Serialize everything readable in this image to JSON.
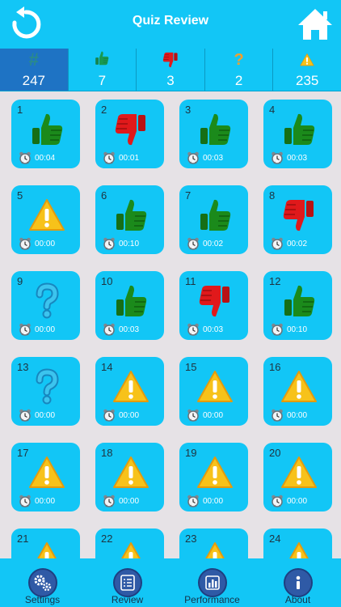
{
  "header": {
    "title": "Quiz Review"
  },
  "stats": [
    {
      "id": "total",
      "icon": "hash-icon",
      "glyph": "#",
      "value": "247",
      "active": true
    },
    {
      "id": "correct",
      "icon": "thumbs-up-icon",
      "value": "7",
      "active": false
    },
    {
      "id": "wrong",
      "icon": "thumbs-down-icon",
      "value": "3",
      "active": false
    },
    {
      "id": "unsure",
      "icon": "question-icon",
      "glyph": "?",
      "value": "2",
      "active": false
    },
    {
      "id": "unanswered",
      "icon": "warning-icon",
      "value": "235",
      "active": false
    }
  ],
  "questions": [
    {
      "num": "1",
      "status": "up",
      "time": "00:04"
    },
    {
      "num": "2",
      "status": "down",
      "time": "00:01"
    },
    {
      "num": "3",
      "status": "up",
      "time": "00:03"
    },
    {
      "num": "4",
      "status": "up",
      "time": "00:03"
    },
    {
      "num": "5",
      "status": "warn",
      "time": "00:00"
    },
    {
      "num": "6",
      "status": "up",
      "time": "00:10"
    },
    {
      "num": "7",
      "status": "up",
      "time": "00:02"
    },
    {
      "num": "8",
      "status": "down",
      "time": "00:02"
    },
    {
      "num": "9",
      "status": "question",
      "time": "00:00"
    },
    {
      "num": "10",
      "status": "up",
      "time": "00:03"
    },
    {
      "num": "11",
      "status": "down",
      "time": "00:03"
    },
    {
      "num": "12",
      "status": "up",
      "time": "00:10"
    },
    {
      "num": "13",
      "status": "question",
      "time": "00:00"
    },
    {
      "num": "14",
      "status": "warn",
      "time": "00:00"
    },
    {
      "num": "15",
      "status": "warn",
      "time": "00:00"
    },
    {
      "num": "16",
      "status": "warn",
      "time": "00:00"
    },
    {
      "num": "17",
      "status": "warn",
      "time": "00:00"
    },
    {
      "num": "18",
      "status": "warn",
      "time": "00:00"
    },
    {
      "num": "19",
      "status": "warn",
      "time": "00:00"
    },
    {
      "num": "20",
      "status": "warn",
      "time": "00:00"
    },
    {
      "num": "21",
      "status": "warn",
      "time": ""
    },
    {
      "num": "22",
      "status": "warn",
      "time": ""
    },
    {
      "num": "23",
      "status": "warn",
      "time": ""
    },
    {
      "num": "24",
      "status": "warn",
      "time": ""
    }
  ],
  "tabs": [
    {
      "id": "settings",
      "label": "Settings",
      "icon": "gears-icon"
    },
    {
      "id": "review",
      "label": "Review",
      "icon": "list-icon"
    },
    {
      "id": "performance",
      "label": "Performance",
      "icon": "bar-chart-icon"
    },
    {
      "id": "about",
      "label": "About",
      "icon": "info-icon"
    }
  ],
  "colors": {
    "bar": "#12c6f6",
    "active_stat": "#1e73c4",
    "correct": "#1b8a1b",
    "wrong": "#e0191b",
    "warning": "#f7c21a",
    "question": "#2fb4e6",
    "background": "#e6e2e6"
  }
}
